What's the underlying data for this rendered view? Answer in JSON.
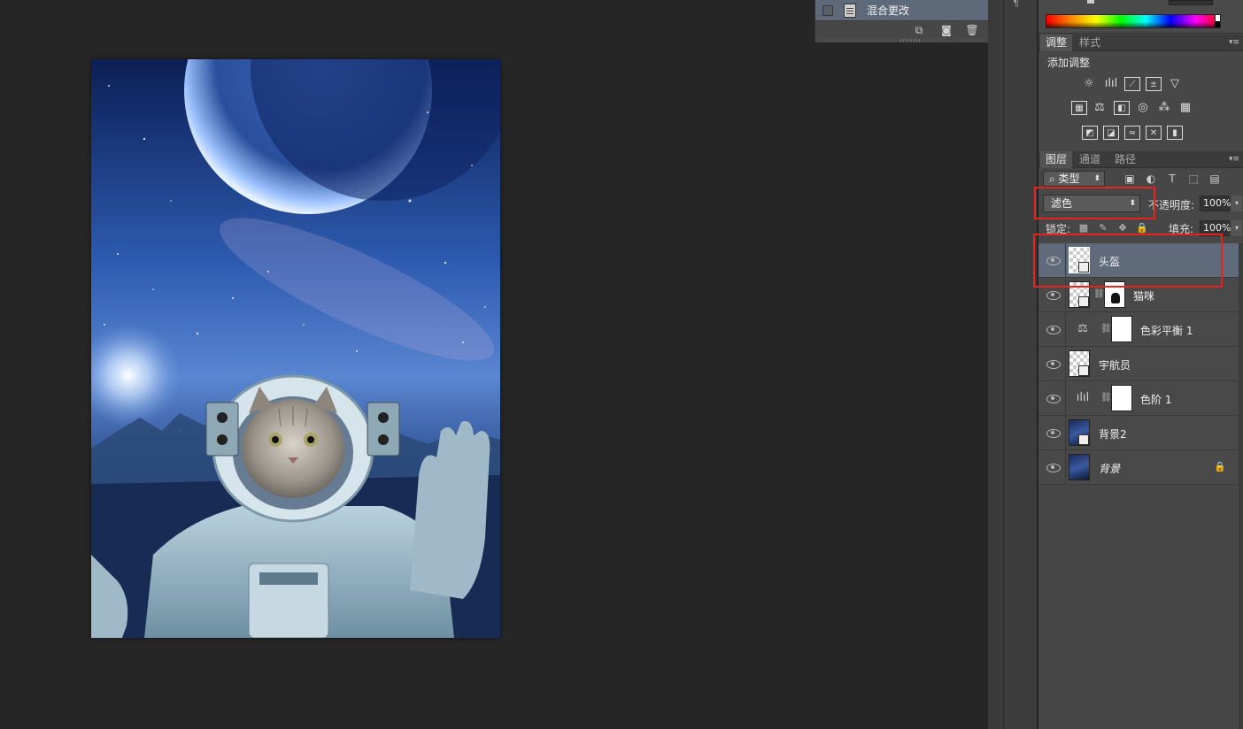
{
  "history_panel": {
    "item_label": "混合更改"
  },
  "adjustments_panel": {
    "tabs": [
      {
        "label": "调整",
        "active": true
      },
      {
        "label": "样式",
        "active": false
      }
    ],
    "title": "添加调整",
    "icons_row1": [
      "brightness-contrast-icon",
      "levels-icon",
      "curves-icon",
      "exposure-icon",
      "vibrance-icon"
    ],
    "icons_row2": [
      "hue-saturation-icon",
      "color-balance-icon",
      "black-white-icon",
      "photo-filter-icon",
      "channel-mixer-icon",
      "color-lookup-icon"
    ],
    "icons_row3": [
      "invert-icon",
      "posterize-icon",
      "threshold-icon",
      "selective-color-icon",
      "gradient-map-icon"
    ]
  },
  "layers_panel": {
    "tabs": [
      {
        "label": "图层",
        "active": true
      },
      {
        "label": "通道",
        "active": false
      },
      {
        "label": "路径",
        "active": false
      }
    ],
    "filter_kind": "类型",
    "blend_mode": "滤色",
    "opacity_label": "不透明度:",
    "opacity_value": "100%",
    "lock_label": "锁定:",
    "fill_label": "填充:",
    "fill_value": "100%",
    "layers": [
      {
        "name": "头盔",
        "selected": true
      },
      {
        "name": "猫咪",
        "selected": false
      },
      {
        "name": "色彩平衡 1",
        "selected": false
      },
      {
        "name": "宇航员",
        "selected": false
      },
      {
        "name": "色阶 1",
        "selected": false
      },
      {
        "name": "背景2",
        "selected": false
      },
      {
        "name": "背景",
        "selected": false,
        "locked": true
      }
    ]
  },
  "colors": {
    "highlight": "#e5231f",
    "selected_layer": "#5f6a7b",
    "workspace": "#262626"
  }
}
